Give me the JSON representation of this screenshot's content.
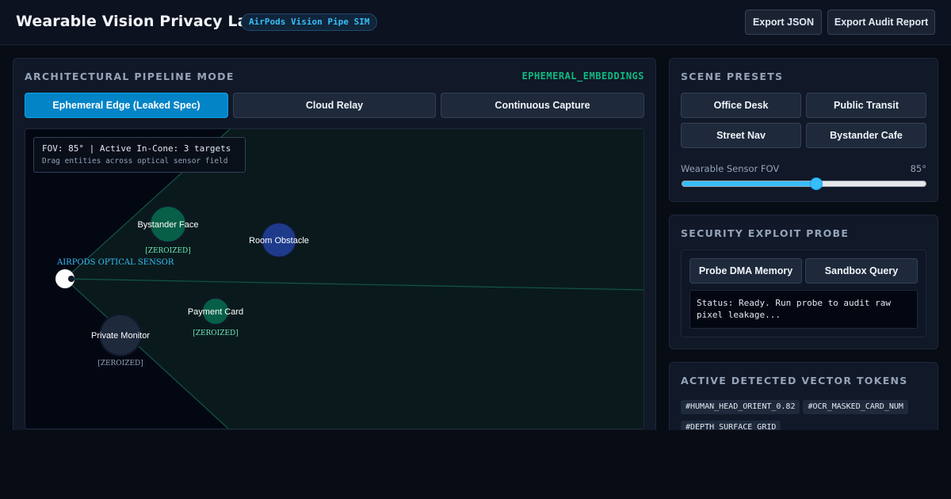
{
  "header": {
    "title": "Wearable Vision Privacy Lab",
    "badge": "AirPods Vision Pipe SIM",
    "export_json": "Export JSON",
    "export_audit": "Export Audit Report"
  },
  "pipeline": {
    "title": "ARCHITECTURAL PIPELINE MODE",
    "mode": "EPHEMERAL_EMBEDDINGS",
    "modes": [
      {
        "label": "Ephemeral Edge (Leaked Spec)",
        "active": true
      },
      {
        "label": "Cloud Relay",
        "active": false
      },
      {
        "label": "Continuous Capture",
        "active": false
      }
    ]
  },
  "stage": {
    "hud_line1": "FOV: 85° | Active In-Cone: 3 targets",
    "hud_line2": "Drag entities across optical sensor field",
    "sensor_label": "AIRPODS OPTICAL SENSOR",
    "fov_degrees": 85,
    "entities": [
      {
        "name": "Bystander Face",
        "tag": "[ZEROIZED]",
        "color": "#065f46",
        "tag_color": "#6ee7b7"
      },
      {
        "name": "Room Obstacle",
        "tag": "",
        "color": "#1e3a8a",
        "tag_color": "#94a3b8"
      },
      {
        "name": "Payment Card",
        "tag": "[ZEROIZED]",
        "color": "#065f46",
        "tag_color": "#6ee7b7"
      },
      {
        "name": "Private Monitor",
        "tag": "[ZEROIZED]",
        "color": "#1e293b",
        "tag_color": "#94a3b8"
      }
    ]
  },
  "presets": {
    "title": "SCENE PRESETS",
    "items": [
      "Office Desk",
      "Public Transit",
      "Street Nav",
      "Bystander Cafe"
    ],
    "slider_label": "Wearable Sensor FOV",
    "slider_value": "85°",
    "slider_fraction": 0.55
  },
  "probe": {
    "title": "SECURITY EXPLOIT PROBE",
    "dma_label": "Probe DMA Memory",
    "sandbox_label": "Sandbox Query",
    "status": "Status: Ready. Run probe to audit raw pixel leakage..."
  },
  "tokens": {
    "title": "ACTIVE DETECTED VECTOR TOKENS",
    "items": [
      "#HUMAN_HEAD_ORIENT_0.82",
      "#OCR_MASKED_CARD_NUM",
      "#DEPTH_SURFACE_GRID"
    ]
  },
  "colors": {
    "accent": "#0284c7",
    "ok": "#10b981",
    "sensor": "#38bdf8"
  }
}
